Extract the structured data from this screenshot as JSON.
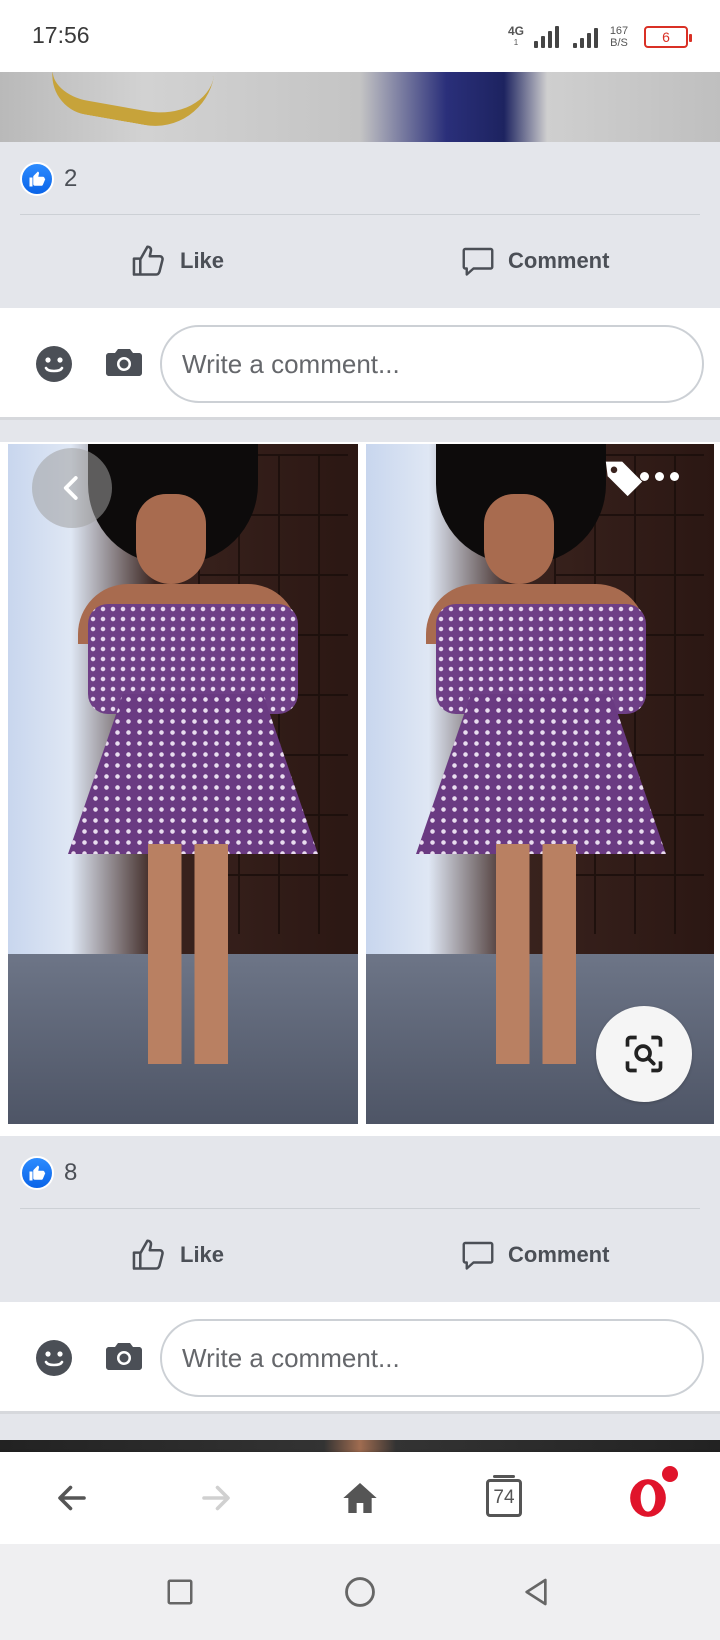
{
  "status_bar": {
    "time": "17:56",
    "network": "4G",
    "network_sub": "1",
    "speed_value": "167",
    "speed_unit": "B/S",
    "battery": "6"
  },
  "posts": [
    {
      "reaction_count": "2",
      "like_label": "Like",
      "comment_label": "Comment",
      "comment_placeholder": "Write a comment..."
    },
    {
      "reaction_count": "8",
      "like_label": "Like",
      "comment_label": "Comment",
      "comment_placeholder": "Write a comment..."
    }
  ],
  "photo_icons": [
    "back-icon",
    "tag-icon",
    "more-icon",
    "visual-search-icon"
  ],
  "browser_bar": {
    "tab_count": "74",
    "icons": [
      "back-arrow-icon",
      "forward-arrow-icon",
      "home-icon",
      "tabs-icon",
      "opera-icon"
    ]
  },
  "system_nav": {
    "icons": [
      "recents-square-icon",
      "home-circle-icon",
      "back-triangle-icon"
    ]
  },
  "colors": {
    "facebook_blue": "#1877f2",
    "opera_red": "#e0142b",
    "battery_red": "#d93025",
    "action_gray": "#4b4f56"
  }
}
